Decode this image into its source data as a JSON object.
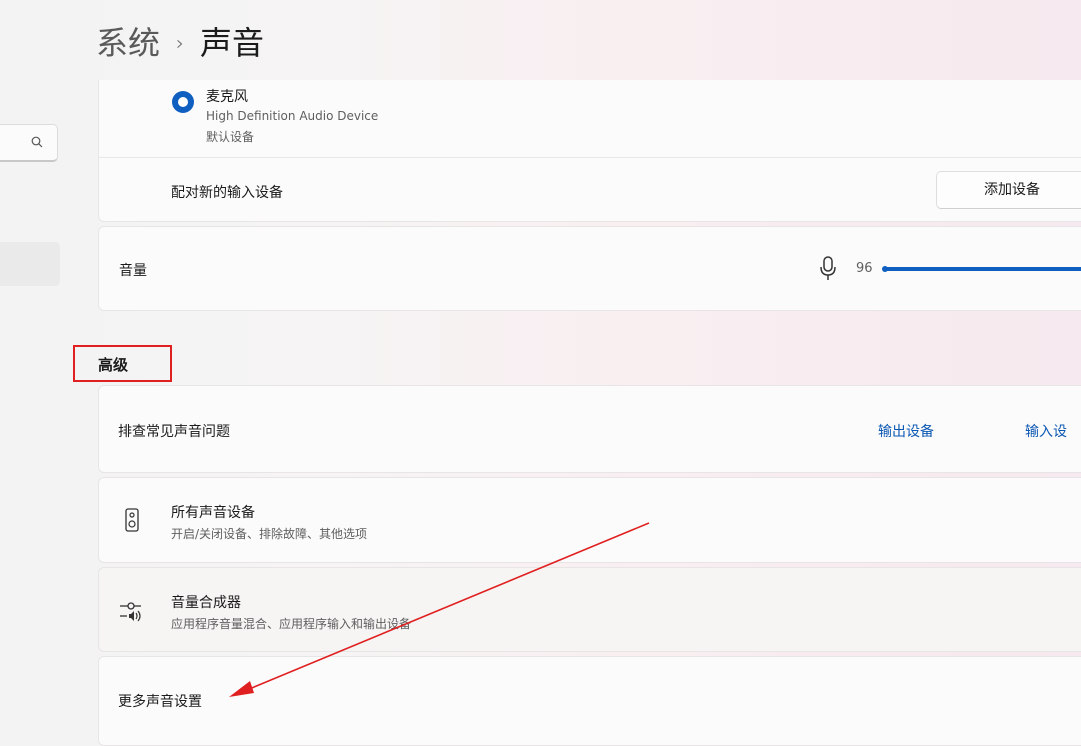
{
  "breadcrumb": {
    "parent": "系统",
    "separator": "›",
    "current": "声音"
  },
  "sidebar": {
    "search_icon": "search-icon"
  },
  "input_device": {
    "name": "麦克风",
    "description": "High Definition Audio Device",
    "status": "默认设备",
    "selected": true
  },
  "pair_input": {
    "label": "配对新的输入设备",
    "button_label": "添加设备"
  },
  "volume": {
    "label": "音量",
    "icon": "microphone-icon",
    "value": "96",
    "level_percent": 96
  },
  "advanced": {
    "title": "高级",
    "troubleshoot": {
      "label": "排查常见声音问题",
      "link_output": "输出设备",
      "link_input": "输入设"
    },
    "all_devices": {
      "title": "所有声音设备",
      "subtitle": "开启/关闭设备、排除故障、其他选项",
      "icon": "speaker-icon"
    },
    "mixer": {
      "title": "音量合成器",
      "subtitle": "应用程序音量混合、应用程序输入和输出设备",
      "icon": "volume-mixer-icon"
    },
    "more_settings": {
      "label": "更多声音设置"
    }
  },
  "annotation": {
    "highlight_color": "#e02020",
    "arrow_color": "#e02020"
  },
  "colors": {
    "accent": "#0f5fc0",
    "link": "#0c58b3"
  }
}
